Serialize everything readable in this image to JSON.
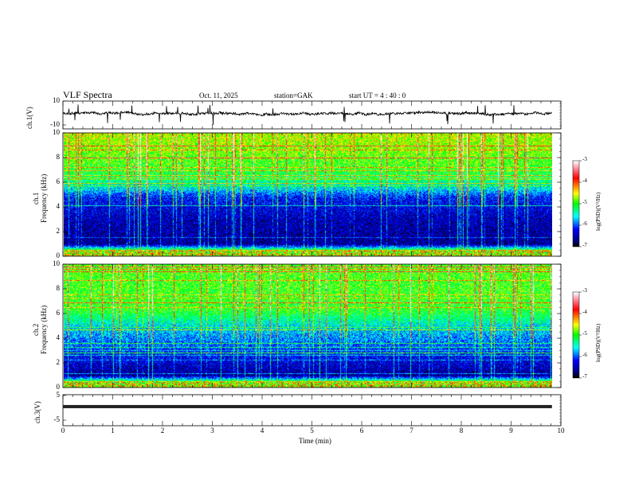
{
  "header": {
    "title": "VLF  Spectra",
    "date": "Oct. 11, 2025",
    "station": "station=GAK",
    "start_ut": "start  UT =   4  : 40 : 0"
  },
  "chart_data": [
    {
      "type": "line",
      "name": "ch1-waveform",
      "ylabel": "ch.1(V)",
      "ylim": [
        -10,
        10
      ],
      "yticks": [
        "10",
        "-10"
      ],
      "x_range_min": [
        0,
        9.82
      ],
      "description_values": {
        "baseline_v": 1,
        "noise_amplitude_v": 1.5
      }
    },
    {
      "type": "heatmap",
      "name": "ch1-spectrogram",
      "ylabel": "ch.1\nFrequency (kHz)",
      "ylabel_line1": "ch.1",
      "ylabel_line2": "Frequency (kHz)",
      "ylim": [
        0,
        10
      ],
      "yticks": [
        "0",
        "2",
        "4",
        "6",
        "8",
        "10"
      ],
      "x_range_min": [
        0,
        9.82
      ],
      "colorbar": {
        "label": "log(PSD)(V²/Hz)",
        "range": [
          -7,
          -3
        ],
        "ticks": [
          "-3",
          "-4",
          "-5",
          "-6",
          "-7"
        ]
      },
      "band_profile_logpsd": [
        [
          0.3,
          -4.3
        ],
        [
          1,
          -6.6
        ],
        [
          3,
          -6.5
        ],
        [
          4.8,
          -6.2
        ],
        [
          5.5,
          -5.6
        ],
        [
          7,
          -5.0
        ],
        [
          10,
          -4.6
        ]
      ]
    },
    {
      "type": "heatmap",
      "name": "ch2-spectrogram",
      "ylabel_line1": "ch.2",
      "ylabel_line2": "Frequency (kHz)",
      "ylim": [
        0,
        10
      ],
      "yticks": [
        "0",
        "2",
        "4",
        "6",
        "8",
        "10"
      ],
      "x_range_min": [
        0,
        9.82
      ],
      "colorbar": {
        "label": "log(PSD)(V²/Hz)",
        "range": [
          -7,
          -3
        ],
        "ticks": [
          "-3",
          "-4",
          "-5",
          "-6",
          "-7"
        ]
      },
      "band_profile_logpsd": [
        [
          0.3,
          -4.3
        ],
        [
          1,
          -6.6
        ],
        [
          2,
          -6.4
        ],
        [
          3.5,
          -6.0
        ],
        [
          5,
          -5.6
        ],
        [
          6.3,
          -5.0
        ],
        [
          10,
          -4.9
        ]
      ]
    },
    {
      "type": "line",
      "name": "ch3-waveform",
      "ylabel": "ch.3(V)",
      "ylim": [
        -5,
        5
      ],
      "yticks": [
        "5",
        "-5"
      ],
      "x_range_min": [
        0,
        9.82
      ],
      "description_values": {
        "baseline_v": 0.5
      }
    }
  ],
  "xaxis": {
    "label": "Time  (min)",
    "ticks": [
      "0",
      "1",
      "2",
      "3",
      "4",
      "5",
      "6",
      "7",
      "8",
      "9",
      "10"
    ],
    "range": [
      0,
      10
    ]
  },
  "colors": {
    "axis": "#000000",
    "trace": "#000000"
  }
}
